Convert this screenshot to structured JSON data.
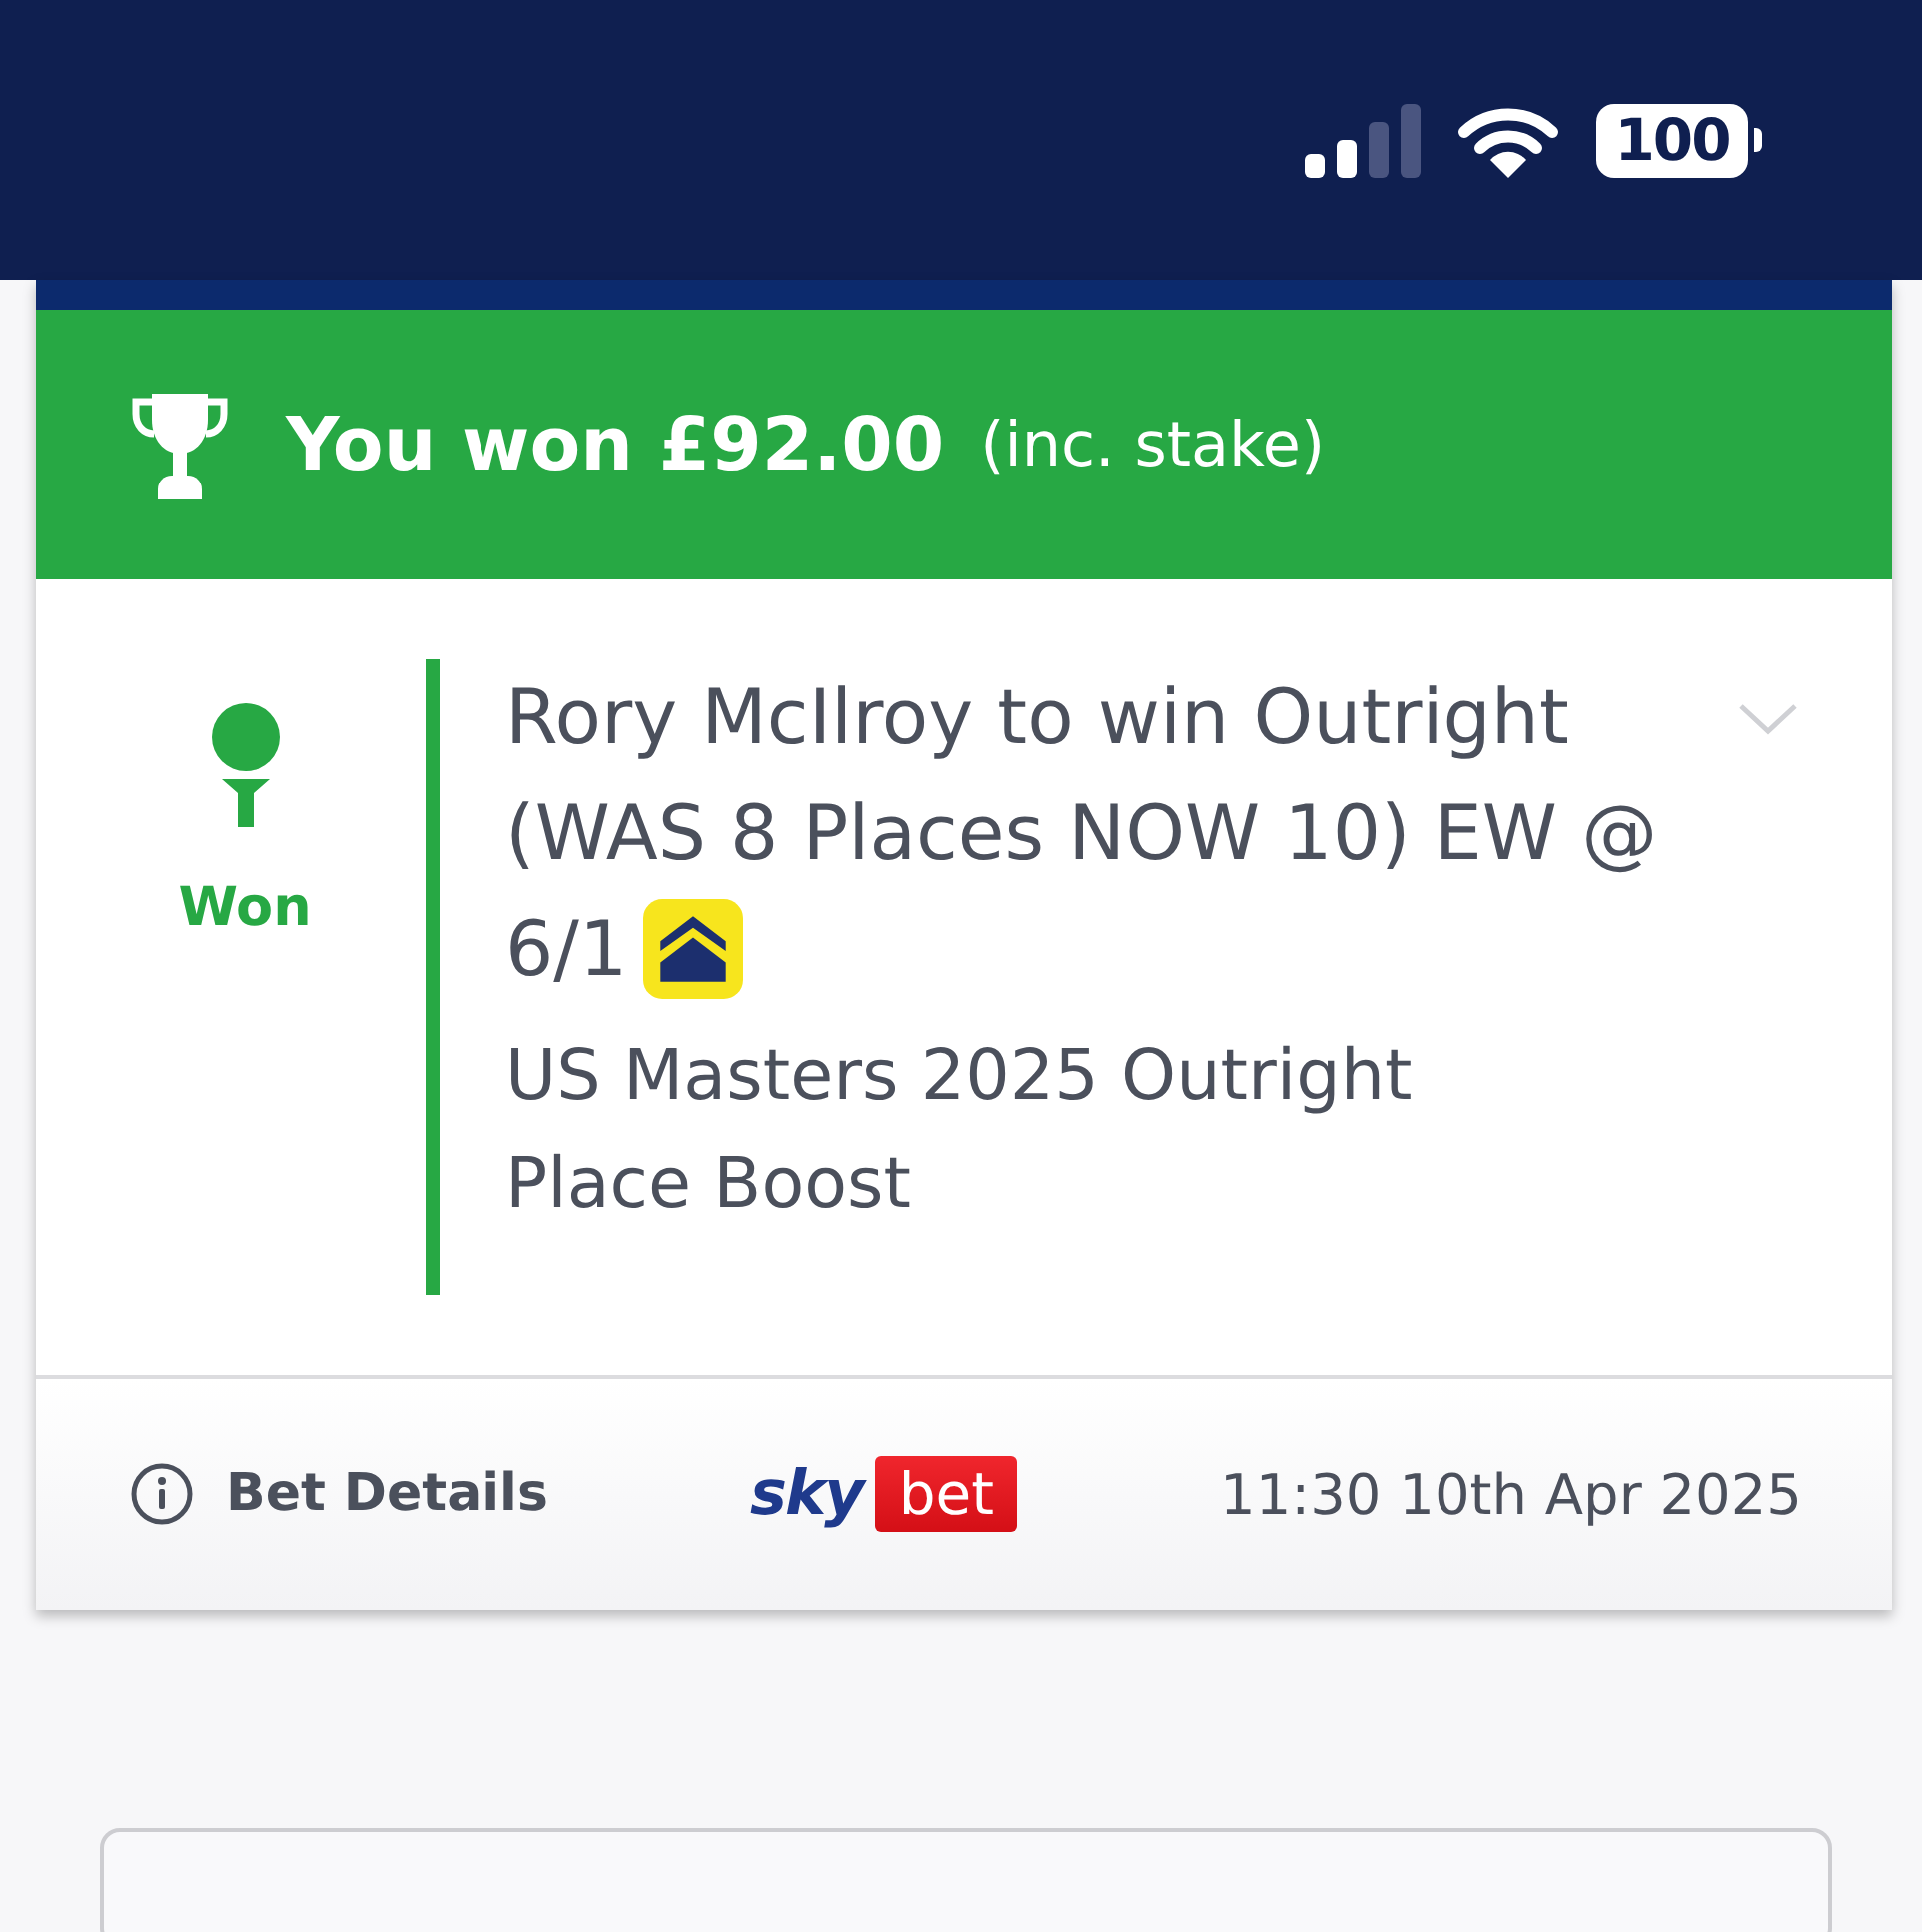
{
  "status_bar": {
    "battery": "100"
  },
  "bet_card": {
    "banner": {
      "headline": "You won £92.00",
      "note": "(inc. stake)"
    },
    "result": {
      "kind": "won",
      "label": "Won"
    },
    "selection": "Rory McIlroy to win Outright (WAS 8 Places NOW 10) EW @ 6/1",
    "boosted": true,
    "market": "US Masters 2025 Outright Place Boost",
    "expanded": false,
    "footer": {
      "details_link": "Bet Details",
      "brand": {
        "wordmark": "sky",
        "badge": "bet"
      },
      "placed_at": "11:30 10th Apr 2025"
    }
  }
}
